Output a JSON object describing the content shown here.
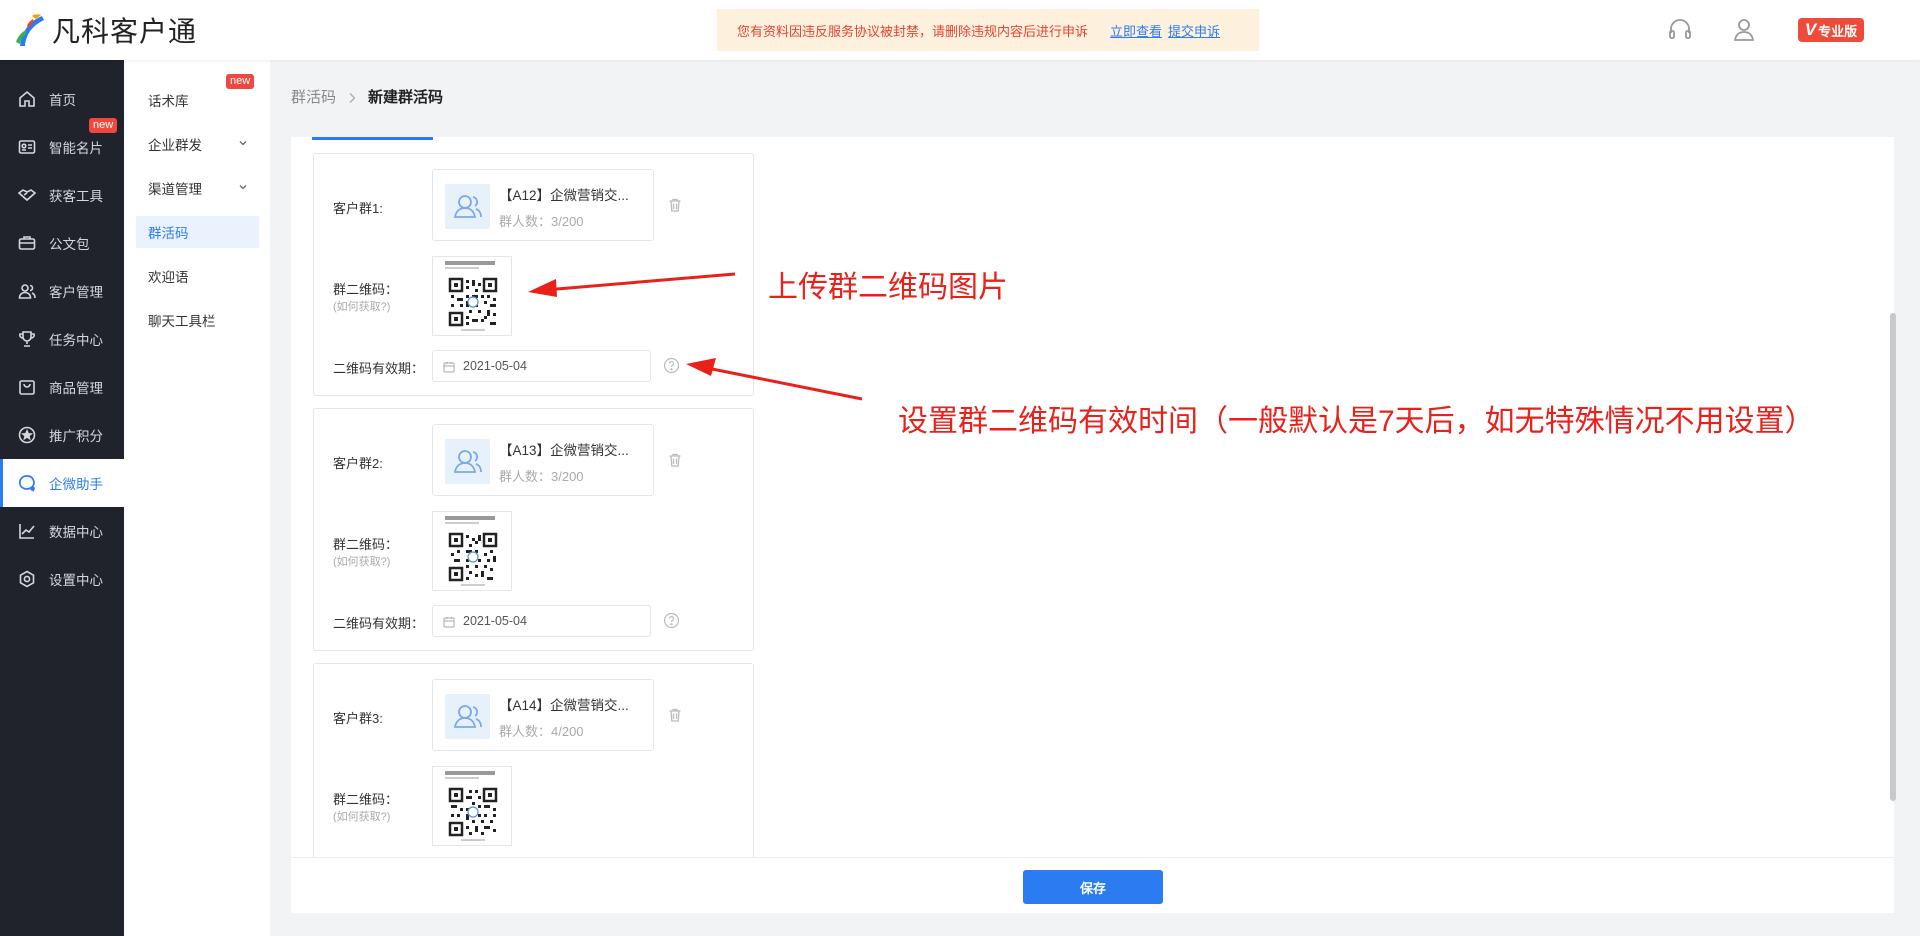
{
  "app": {
    "title": "凡科客户通"
  },
  "notice": {
    "text": "您有资料因违反服务协议被封禁，请删除违规内容后进行申诉",
    "link_view": "立即查看",
    "link_appeal": "提交申诉"
  },
  "header": {
    "edition_badge_v": "V",
    "edition_badge_text": "专业版"
  },
  "sidebar": {
    "items": [
      {
        "label": "首页",
        "icon": "home-icon"
      },
      {
        "label": "智能名片",
        "icon": "card-icon",
        "badge": "new"
      },
      {
        "label": "获客工具",
        "icon": "handshake-icon"
      },
      {
        "label": "公文包",
        "icon": "briefcase-icon"
      },
      {
        "label": "客户管理",
        "icon": "users-icon"
      },
      {
        "label": "任务中心",
        "icon": "trophy-icon"
      },
      {
        "label": "商品管理",
        "icon": "bag-icon"
      },
      {
        "label": "推广积分",
        "icon": "points-icon"
      },
      {
        "label": "企微助手",
        "icon": "wecom-icon",
        "active": true
      },
      {
        "label": "数据中心",
        "icon": "chart-icon"
      },
      {
        "label": "设置中心",
        "icon": "settings-icon"
      }
    ]
  },
  "submenu": {
    "items": [
      {
        "label": "话术库",
        "badge": "new"
      },
      {
        "label": "企业群发",
        "expandable": true
      },
      {
        "label": "渠道管理",
        "expandable": true
      },
      {
        "label": "群活码",
        "active": true
      },
      {
        "label": "欢迎语"
      },
      {
        "label": "聊天工具栏"
      }
    ]
  },
  "breadcrumb": {
    "parent": "群活码",
    "current": "新建群活码"
  },
  "form": {
    "qr_label": "群二维码：",
    "qr_help": "(如何获取?)",
    "validity_label": "二维码有效期：",
    "groups": [
      {
        "label": "客户群1:",
        "name": "【A12】企微营销交...",
        "count": "群人数：3/200",
        "date": "2021-05-04"
      },
      {
        "label": "客户群2:",
        "name": "【A13】企微营销交...",
        "count": "群人数：3/200",
        "date": "2021-05-04"
      },
      {
        "label": "客户群3:",
        "name": "【A14】企微营销交...",
        "count": "群人数：4/200",
        "date": ""
      }
    ],
    "save_label": "保存"
  },
  "annotations": {
    "upload": "上传群二维码图片",
    "validity": "设置群二维码有效时间（一般默认是7天后，如无特殊情况不用设置）",
    "color": "#e8211b"
  },
  "colors": {
    "accent": "#2b7cf0",
    "sidebar_bg": "#20232b",
    "danger": "#f0483e"
  }
}
